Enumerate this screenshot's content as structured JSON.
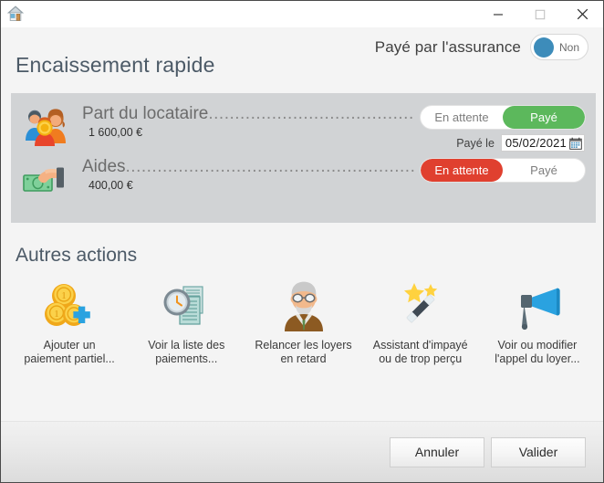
{
  "window": {
    "app_icon": "house-icon",
    "minimize_label": "Minimize",
    "maximize_label": "Maximize",
    "close_label": "Close"
  },
  "header": {
    "insurance_label": "Payé par l'assurance",
    "insurance_toggle_state": "Non",
    "page_title": "Encaissement rapide"
  },
  "payments": {
    "rows": [
      {
        "icon": "family-with-coin-icon",
        "label": "Part du locataire",
        "leader": "..................................................",
        "amount": "1 600,00 €",
        "segments": [
          {
            "label": "En attente",
            "state": "inactive"
          },
          {
            "label": "Payé",
            "state": "active-green"
          }
        ],
        "paid_on_label": "Payé le",
        "paid_on_value": "05/02/2021",
        "calendar_icon": "calendar-icon"
      },
      {
        "icon": "hand-with-banknote-icon",
        "label": "Aides",
        "leader": "...............................................................",
        "amount": "400,00 €",
        "segments": [
          {
            "label": "En attente",
            "state": "active-red"
          },
          {
            "label": "Payé",
            "state": "inactive"
          }
        ]
      }
    ]
  },
  "actions": {
    "title": "Autres actions",
    "items": [
      {
        "icon": "coins-plus-icon",
        "line1": "Ajouter un",
        "line2": "paiement partiel..."
      },
      {
        "icon": "clock-documents-icon",
        "line1": "Voir la liste des",
        "line2": "paiements..."
      },
      {
        "icon": "elderly-man-icon",
        "line1": "Relancer les loyers",
        "line2": "en retard"
      },
      {
        "icon": "magic-wand-icon",
        "line1": "Assistant d'impayé",
        "line2": "ou de trop perçu"
      },
      {
        "icon": "megaphone-icon",
        "line1": "Voir ou modifier",
        "line2": "l'appel du loyer..."
      }
    ]
  },
  "footer": {
    "cancel_label": "Annuler",
    "validate_label": "Valider"
  },
  "colors": {
    "accent_blue": "#3d8cba",
    "paid_green": "#5cb85c",
    "pending_red": "#e0402f",
    "panel_gray": "#d1d3d5",
    "dialog_bg": "#f4f4f4",
    "title_text": "#4c5a67"
  }
}
